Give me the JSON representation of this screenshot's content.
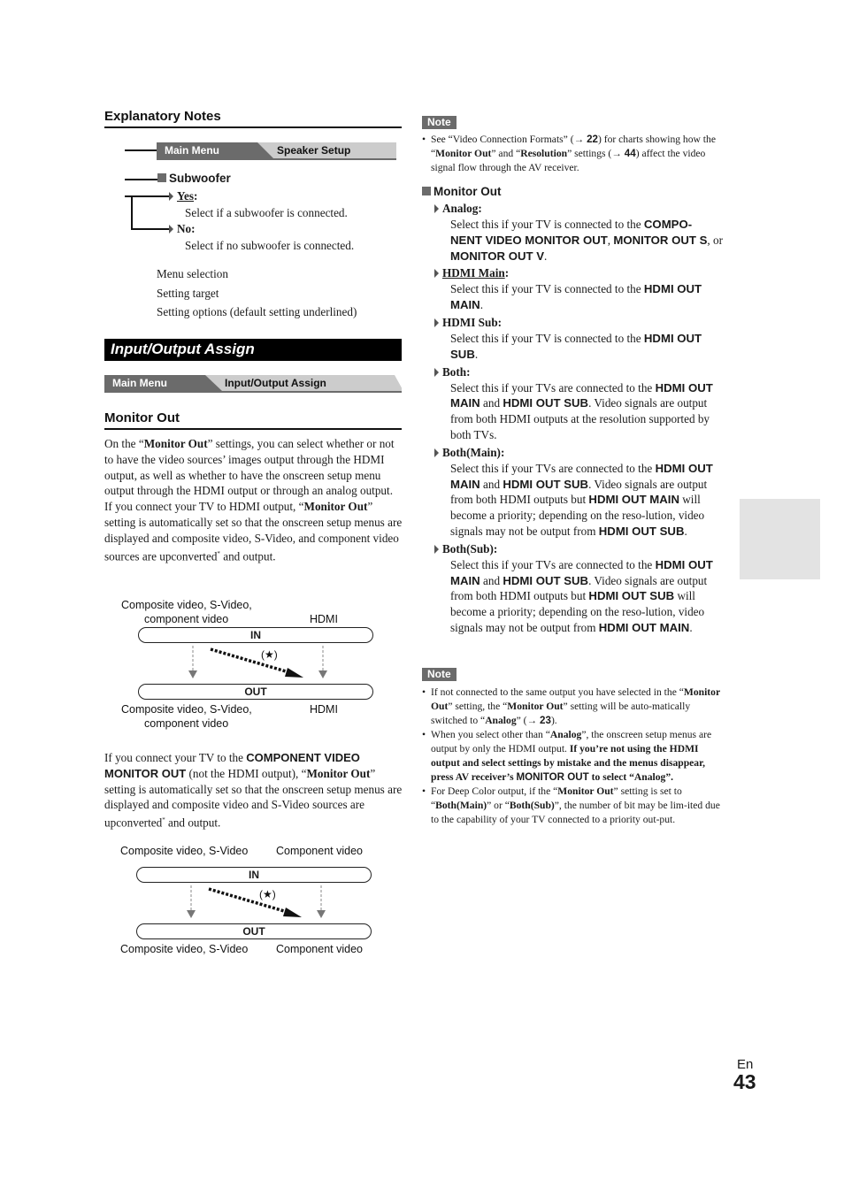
{
  "explanatory": {
    "heading": "Explanatory Notes",
    "crumb_main": "Main Menu",
    "crumb_target": "Speaker Setup",
    "setting_name": "Subwoofer",
    "options": [
      {
        "label": "Yes",
        "desc": "Select if a subwoofer is connected.",
        "default": true
      },
      {
        "label": "No",
        "desc": "Select if no subwoofer is connected.",
        "default": false
      }
    ],
    "legend": [
      "Menu selection",
      "Setting target",
      "Setting options (default setting underlined)"
    ]
  },
  "section": {
    "title": "Input/Output Assign",
    "crumb_main": "Main Menu",
    "crumb_target": "Input/Output Assign",
    "subheading": "Monitor Out"
  },
  "body": {
    "p1_a": "On the “",
    "p1_b": "Monitor Out",
    "p1_c": "” settings, you can select whether or not to have the video sources’ images output through the HDMI output, as well as whether to have the onscreen setup menu output through the HDMI output or through an analog output.",
    "p2_a": "If you connect your TV to HDMI output, “",
    "p2_b": "Monitor Out",
    "p2_c": "” setting is automatically set so that the onscreen setup menus are displayed and composite video, S-Video, and component video sources are upconverted",
    "p2_d": " and output.",
    "p3_a": "If you connect your TV to the ",
    "p3_b": "COMPONENT VIDEO MONITOR OUT",
    "p3_c": " (not the HDMI output), “",
    "p3_d": "Monitor Out",
    "p3_e": "” setting is automatically set so that the onscreen setup menus are displayed and composite video and S-Video sources are upconverted",
    "p3_f": " and output.",
    "asterisk": "*"
  },
  "diagram1": {
    "in_left_1": "Composite video, S-Video,",
    "in_left_2": "component video",
    "in_right": "HDMI",
    "in_label": "IN",
    "out_label": "OUT",
    "star": "(★)",
    "out_left_1": "Composite video, S-Video,",
    "out_left_2": "component video",
    "out_right": "HDMI"
  },
  "diagram2": {
    "in_left": "Composite video, S-Video",
    "in_right": "Component video",
    "in_label": "IN",
    "out_label": "OUT",
    "star": "(★)",
    "out_left": "Composite video, S-Video",
    "out_right": "Component video"
  },
  "right": {
    "note1_badge": "Note",
    "note1": {
      "a": "See “Video Connection Formats” (→ ",
      "ref1": "22",
      "b": ") for charts showing how the “",
      "c": "Monitor Out",
      "d": "” and “",
      "e": "Resolution",
      "f": "” settings (→ ",
      "ref2": "44",
      "g": ") affect the video signal flow through the AV receiver."
    },
    "setting_title": "Monitor Out",
    "options": {
      "analog": {
        "label": "Analog",
        "t1": "Select this if your TV is connected to the ",
        "b1": "COMPO-NENT VIDEO MONITOR OUT",
        "t2": ", ",
        "b2": "MONITOR OUT S",
        "t3": ", or ",
        "b3": "MONITOR OUT V",
        "t4": "."
      },
      "hdmi_main": {
        "label": "HDMI Main",
        "t1": "Select this if your TV is connected to the ",
        "b1": "HDMI OUT MAIN",
        "t2": "."
      },
      "hdmi_sub": {
        "label": "HDMI Sub",
        "t1": "Select this if your TV is connected to the ",
        "b1": "HDMI OUT SUB",
        "t2": "."
      },
      "both": {
        "label": "Both",
        "t1": "Select this if your TVs are connected to the ",
        "b1": "HDMI OUT MAIN",
        "t2": " and ",
        "b2": "HDMI OUT SUB",
        "t3": ". Video signals are output from both HDMI outputs at the resolution supported by both TVs."
      },
      "both_main": {
        "label": "Both(Main)",
        "t1": "Select this if your TVs are connected to the ",
        "b1": "HDMI OUT MAIN",
        "t2": " and ",
        "b2": "HDMI OUT SUB",
        "t3": ". Video signals are output from both HDMI outputs but ",
        "b3": "HDMI OUT MAIN",
        "t4": " will become a priority; depending on the reso-lution, video signals may not be output from ",
        "b4": "HDMI OUT SUB",
        "t5": "."
      },
      "both_sub": {
        "label": "Both(Sub)",
        "t1": "Select this if your TVs are connected to the ",
        "b1": "HDMI OUT MAIN",
        "t2": " and ",
        "b2": "HDMI OUT SUB",
        "t3": ". Video signals are output from both HDMI outputs but ",
        "b3": "HDMI OUT SUB",
        "t4": " will become a priority; depending on the reso-lution, video signals may not be output from ",
        "b4": "HDMI OUT MAIN",
        "t5": "."
      }
    },
    "note2_badge": "Note",
    "note2": [
      {
        "a": "If not connected to the same output you have selected in the “",
        "b": "Monitor Out",
        "c": "” setting, the “",
        "d": "Monitor Out",
        "e": "” setting will be auto-matically switched to “",
        "f": "Analog",
        "g": "” (→ ",
        "ref": "23",
        "h": ")."
      },
      {
        "a": "When you select other than “",
        "b": "Analog",
        "c": "”, the onscreen setup menus are output by only the HDMI output. ",
        "d": "If you’re not using the HDMI output and select settings by mistake and the menus disappear, press AV receiver’s ",
        "e": "MONITOR OUT",
        "f": " to select “Analog”."
      },
      {
        "a": "For Deep Color output, if the “",
        "b": "Monitor Out",
        "c": "” setting is set to “",
        "d": "Both(Main)",
        "e": "” or “",
        "f": "Both(Sub)",
        "g": "”, the number of bit may be lim-ited due to the capability of your TV connected to a priority out-put."
      }
    ]
  },
  "footer": {
    "lang": "En",
    "page": "43"
  }
}
